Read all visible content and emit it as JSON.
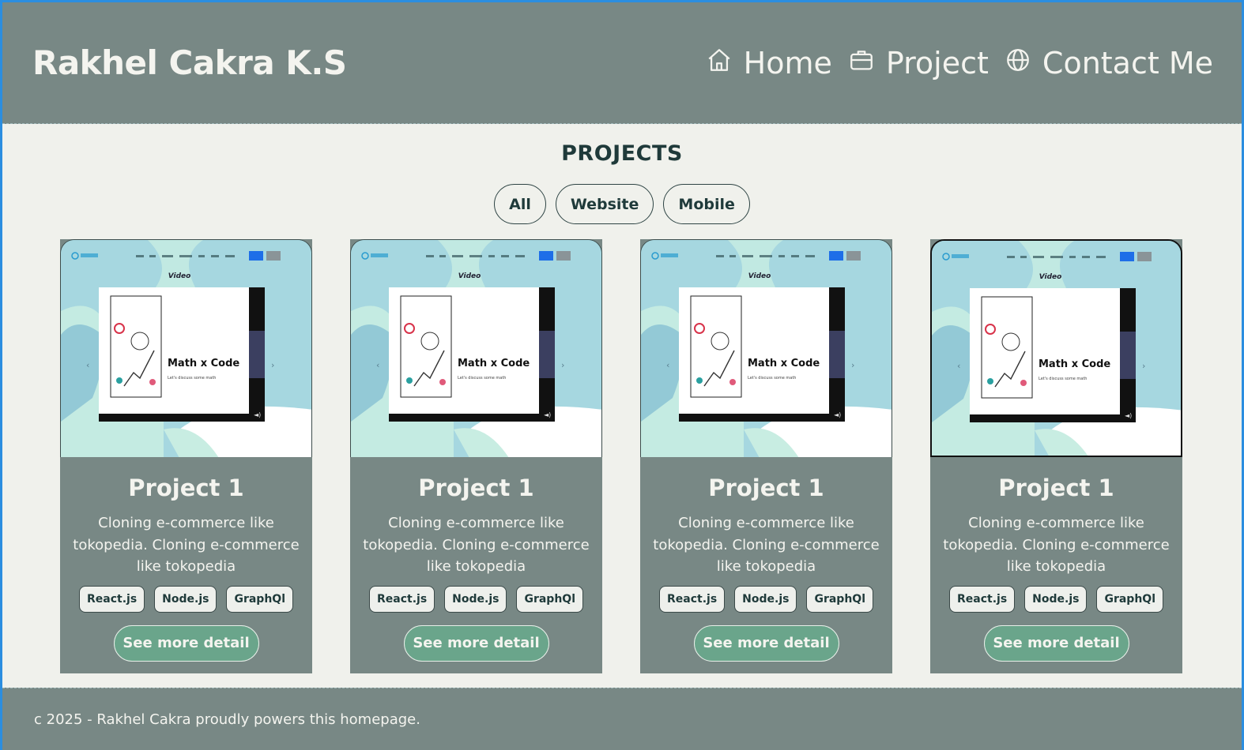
{
  "header": {
    "brand": "Rakhel Cakra K.S",
    "nav": [
      {
        "label": "Home",
        "icon": "home-icon"
      },
      {
        "label": "Project",
        "icon": "briefcase-icon"
      },
      {
        "label": "Contact Me",
        "icon": "globe-icon"
      }
    ]
  },
  "projects": {
    "title": "PROJECTS",
    "filters": [
      "All",
      "Website",
      "Mobile"
    ],
    "cards": [
      {
        "title": "Project 1",
        "description": "Cloning e-commerce like tokopedia. Cloning e-commerce like tokopedia",
        "tags": [
          "React.js",
          "Node.js",
          "GraphQl"
        ],
        "button": "See more detail",
        "thumbnail": {
          "heading": "Video",
          "slide_title": "Math x Code",
          "slide_subtitle": "Let's discuss some math"
        }
      },
      {
        "title": "Project 1",
        "description": "Cloning e-commerce like tokopedia. Cloning e-commerce like tokopedia",
        "tags": [
          "React.js",
          "Node.js",
          "GraphQl"
        ],
        "button": "See more detail",
        "thumbnail": {
          "heading": "Video",
          "slide_title": "Math x Code",
          "slide_subtitle": "Let's discuss some math"
        }
      },
      {
        "title": "Project 1",
        "description": "Cloning e-commerce like tokopedia. Cloning e-commerce like tokopedia",
        "tags": [
          "React.js",
          "Node.js",
          "GraphQl"
        ],
        "button": "See more detail",
        "thumbnail": {
          "heading": "Video",
          "slide_title": "Math x Code",
          "slide_subtitle": "Let's discuss some math"
        }
      },
      {
        "title": "Project 1",
        "description": "Cloning e-commerce like tokopedia. Cloning e-commerce like tokopedia",
        "tags": [
          "React.js",
          "Node.js",
          "GraphQl"
        ],
        "button": "See more detail",
        "thumbnail": {
          "heading": "Video",
          "slide_title": "Math x Code",
          "slide_subtitle": "Let's discuss some math"
        }
      }
    ]
  },
  "footer": {
    "text": "c 2025 - Rakhel Cakra proudly powers this homepage."
  },
  "colors": {
    "header_bg": "#788885",
    "page_bg": "#f0f1ec",
    "button_green": "#6aa58b",
    "text_dark": "#1f3a3a"
  }
}
